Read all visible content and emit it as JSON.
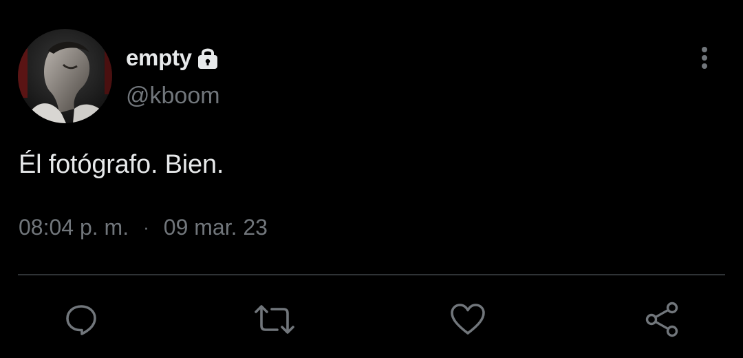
{
  "user": {
    "display_name": "empty",
    "handle": "@kboom",
    "protected_icon": "lock-icon",
    "avatar": "avatar"
  },
  "tweet": {
    "text": "Él fotógrafo. Bien.",
    "time": "08:04 p. m.",
    "separator": "·",
    "date": "09 mar. 23"
  },
  "actions": {
    "reply_icon": "reply-icon",
    "retweet_icon": "retweet-icon",
    "like_icon": "heart-icon",
    "share_icon": "share-icon",
    "more_icon": "more-vertical-icon"
  },
  "colors": {
    "background": "#000000",
    "primary_text": "#e7e9ea",
    "secondary_text": "#71767b",
    "divider": "#2f3336"
  }
}
